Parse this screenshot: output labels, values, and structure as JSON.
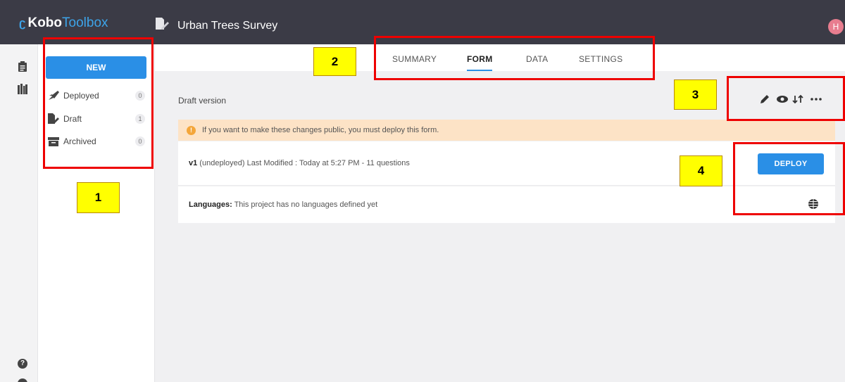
{
  "app": {
    "logo_mark": "ʗ",
    "logo_kobo": "Kobo",
    "logo_toolbox": "Toolbox",
    "project_title": "Urban Trees Survey",
    "avatar_initial": "H"
  },
  "sidebar": {
    "new_label": "NEW",
    "items": [
      {
        "label": "Deployed",
        "count": "0",
        "icon": "rocket-icon"
      },
      {
        "label": "Draft",
        "count": "1",
        "icon": "draft-icon"
      },
      {
        "label": "Archived",
        "count": "0",
        "icon": "archive-icon"
      }
    ]
  },
  "tabs": [
    {
      "label": "SUMMARY"
    },
    {
      "label": "FORM"
    },
    {
      "label": "DATA"
    },
    {
      "label": "SETTINGS"
    }
  ],
  "form": {
    "draft_label": "Draft version",
    "alert_text": "If you want to make these changes public, you must deploy this form.",
    "version_bold": "v1",
    "version_text": " (undeployed) Last Modified : Today at 5:27 PM - 11 questions",
    "deploy_label": "DEPLOY",
    "languages_bold": "Languages:",
    "languages_text": " This project has no languages defined yet"
  },
  "annotations": {
    "n1": "1",
    "n2": "2",
    "n3": "3",
    "n4": "4"
  },
  "colors": {
    "topbar": "#3b3b46",
    "accent": "#2a8fe6",
    "annotation_red": "#ee0000",
    "annotation_yellow": "#ffff00",
    "alert_bg": "#fde3c6"
  }
}
